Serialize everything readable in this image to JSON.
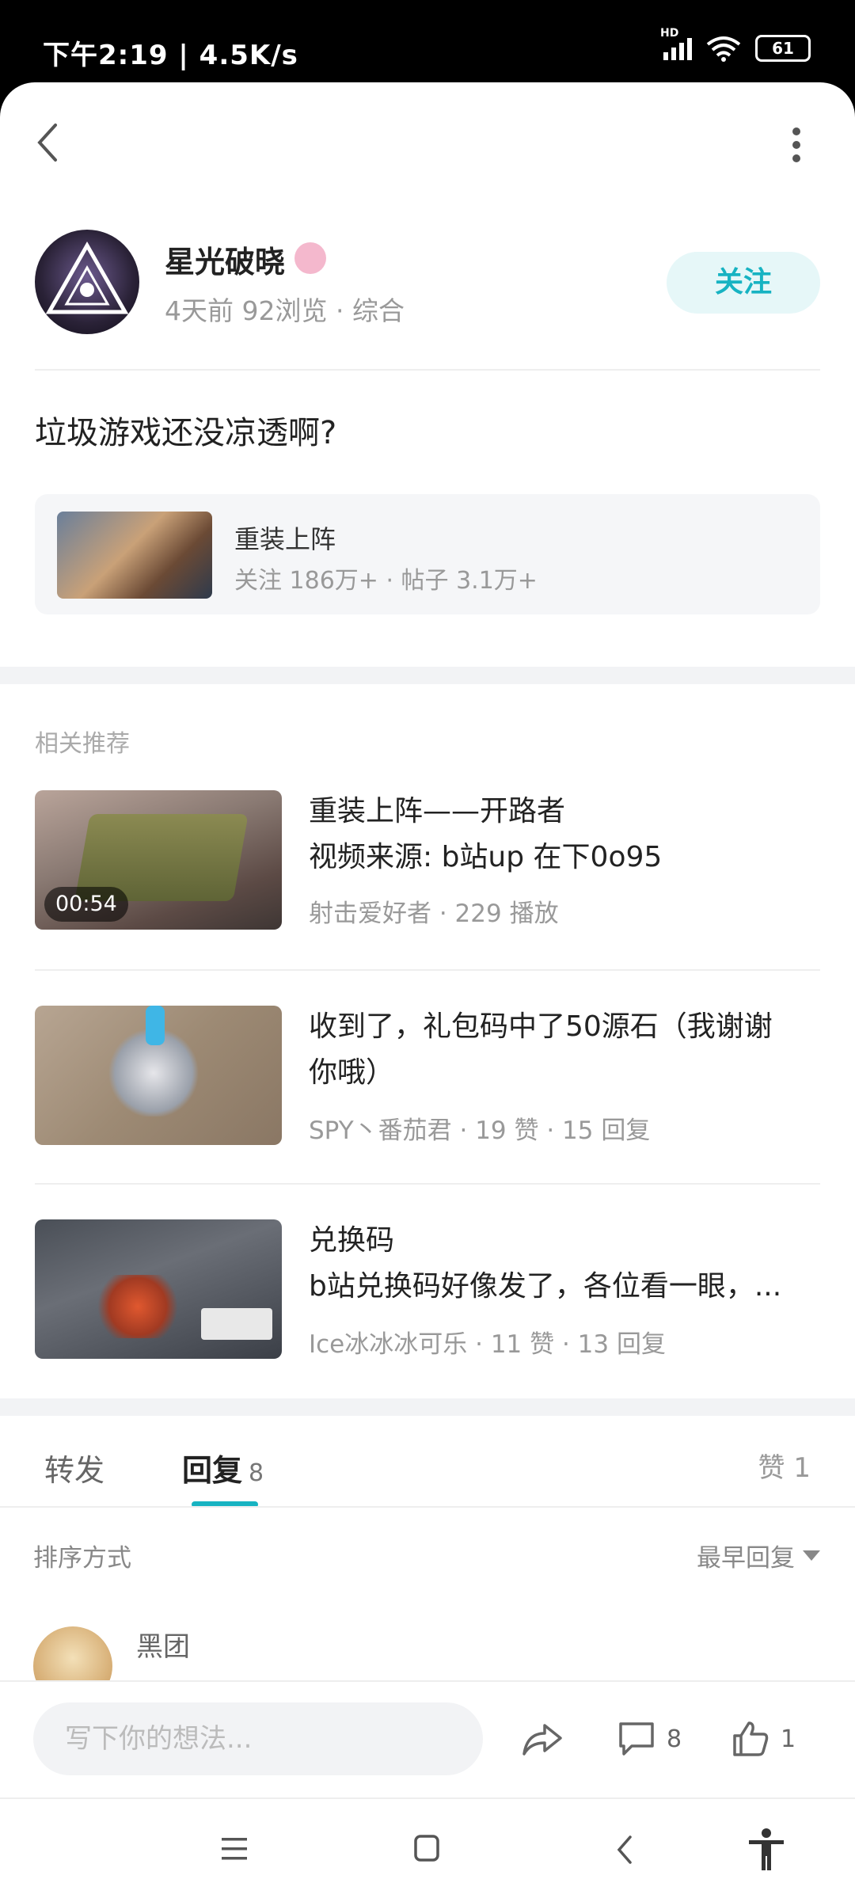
{
  "status": {
    "time_speed": "下午2:19 | 4.5K/s",
    "network": "HD",
    "battery": "61"
  },
  "author": {
    "name": "星光破晓",
    "meta": "4天前  92浏览  ·  综合",
    "follow_label": "关注"
  },
  "post": {
    "title": "垃圾游戏还没凉透啊?"
  },
  "circle": {
    "name": "重装上阵",
    "stats": "关注 186万+  ·  帖子 3.1万+"
  },
  "recommend": {
    "section_label": "相关推荐",
    "items": [
      {
        "title_line1": "重装上阵——开路者",
        "title_line2": "视频来源: b站up 在下0o95",
        "meta": "射击爱好者  ·  229 播放",
        "duration": "00:54"
      },
      {
        "title_line1": "收到了，礼包码中了50源石（我谢谢",
        "title_line2": "你哦）",
        "meta": "SPY丶番茄君  ·  19 赞  ·  15 回复"
      },
      {
        "title_line1": "兑换码",
        "title_line2": "b站兑换码好像发了，各位看一眼，...",
        "meta": "Ice冰冰冰可乐  ·  11 赞  ·  13 回复"
      }
    ]
  },
  "tabs": {
    "forward": "转发",
    "reply": "回复",
    "reply_count": "8",
    "like": "赞 1"
  },
  "sort": {
    "label": "排序方式",
    "value": "最早回复"
  },
  "first_reply": {
    "name": "黑团"
  },
  "bottom": {
    "input_placeholder": "写下你的想法...",
    "comment_count": "8",
    "like_count": "1"
  },
  "colors": {
    "accent": "#17b3c2",
    "background": "#ffffff",
    "section_gap": "#f2f3f5"
  }
}
